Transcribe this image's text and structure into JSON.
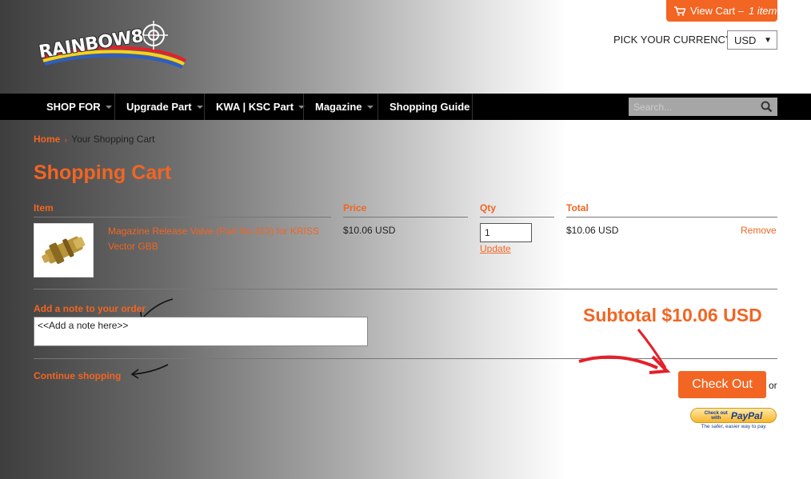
{
  "brand": {
    "logo_text": "RAINBOW8"
  },
  "header": {
    "view_cart_label": "View Cart –",
    "cart_count": "1 item",
    "currency_label": "PICK YOUR CURRENCY",
    "currency_value": "USD"
  },
  "nav": {
    "items": [
      {
        "label": "SHOP FOR",
        "dropdown": true
      },
      {
        "label": "Upgrade Part",
        "dropdown": true
      },
      {
        "label": "KWA | KSC Part",
        "dropdown": true
      },
      {
        "label": "Magazine",
        "dropdown": true
      },
      {
        "label": "Shopping Guide",
        "dropdown": false
      }
    ],
    "search_placeholder": "Search..."
  },
  "breadcrumb": {
    "home": "Home",
    "separator": "›",
    "current": "Your Shopping Cart"
  },
  "page_title": "Shopping Cart",
  "cart": {
    "headers": {
      "item": "Item",
      "price": "Price",
      "qty": "Qty",
      "total": "Total"
    },
    "rows": [
      {
        "name": "Magazine Release Valve (Part No.313) for KRISS Vector GBB",
        "price": "$10.06 USD",
        "qty": "1",
        "update_label": "Update",
        "total": "$10.06 USD",
        "remove_label": "Remove"
      }
    ]
  },
  "note": {
    "label": "Add a note to your order",
    "value": "<<Add a note here>>"
  },
  "summary": {
    "subtotal": "Subtotal $10.06 USD",
    "continue_label": "Continue shopping",
    "checkout_label": "Check Out",
    "or_label": "or",
    "paypal_line1": "Check out",
    "paypal_line2": "with",
    "paypal_brand": "PayPal",
    "paypal_tagline": "The safer, easier way to pay"
  },
  "colors": {
    "accent": "#f26522",
    "nav_bg": "#000000",
    "paypal_blue": "#1a3e8c"
  }
}
